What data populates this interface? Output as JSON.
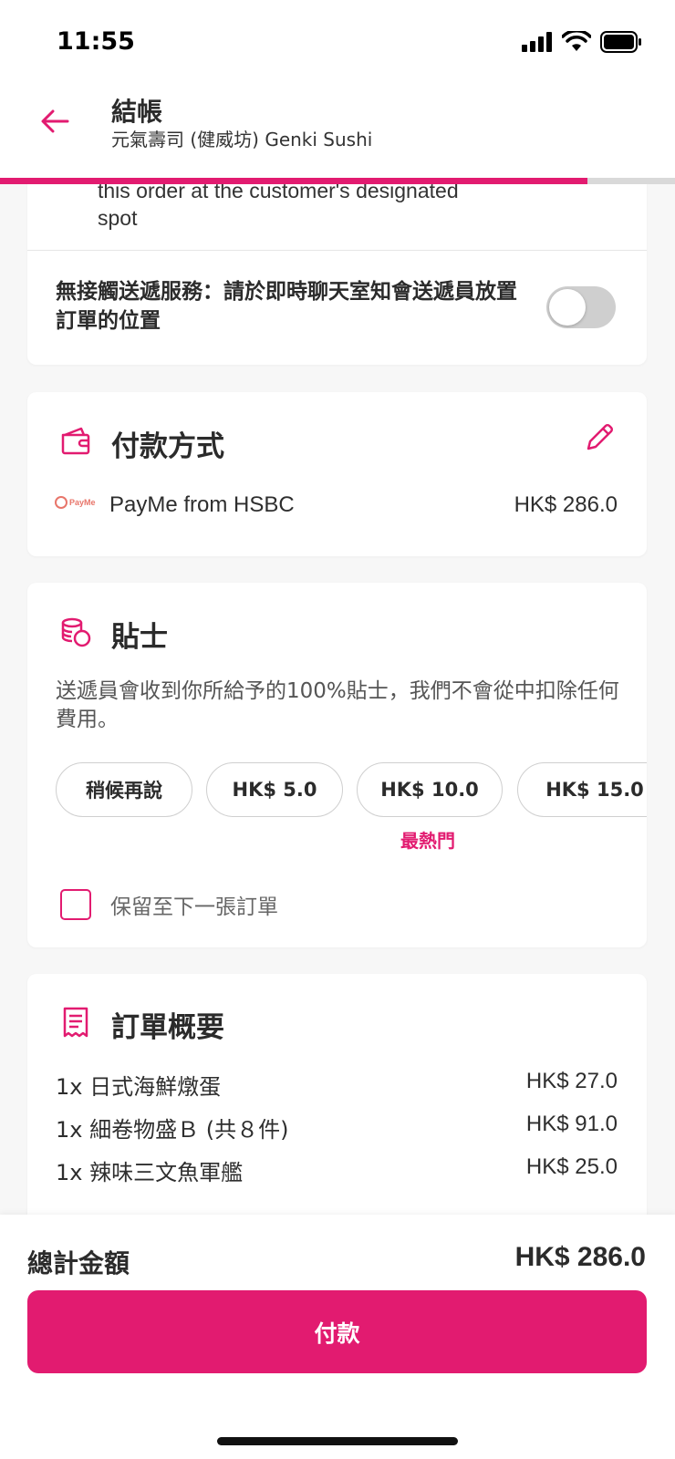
{
  "status_bar": {
    "time": "11:55"
  },
  "header": {
    "title": "結帳",
    "subtitle": "元氣壽司 (健威坊) Genki Sushi",
    "progress": 0.87
  },
  "delivery": {
    "partial_text": "this order at the customer's designated",
    "partial_text_2": "spot",
    "contactless_label": "無接觸送遞服務：請於即時聊天室知會送遞員放置訂單的位置",
    "contactless_enabled": false
  },
  "payment": {
    "section_title": "付款方式",
    "logo_text": "PayMe",
    "method_name": "PayMe from HSBC",
    "amount": "HK$ 286.0"
  },
  "tip": {
    "section_title": "貼士",
    "description": "送遞員會收到你所給予的100%貼士，我們不會從中扣除任何費用。",
    "options": [
      {
        "label": "稍候再說"
      },
      {
        "label": "HK$ 5.0"
      },
      {
        "label": "HK$ 10.0"
      },
      {
        "label": "HK$ 15.0"
      }
    ],
    "popular_label": "最熱門",
    "keep_label": "保留至下一張訂單",
    "keep_checked": false
  },
  "order_summary": {
    "section_title": "訂單概要",
    "items": [
      {
        "name": "1x 日式海鮮燉蛋",
        "price": "HK$ 27.0"
      },
      {
        "name": "1x 細卷物盛Ｂ (共８件)",
        "price": "HK$ 91.0"
      },
      {
        "name": "1x 辣味三文魚軍艦",
        "price": "HK$ 25.0"
      }
    ]
  },
  "footer": {
    "total_label": "總計金額",
    "total_amount": "HK$ 286.0",
    "pay_button_label": "付款"
  },
  "colors": {
    "accent": "#e21b70",
    "toggle_off": "#cfcfcf",
    "background": "#f7f7f7"
  }
}
